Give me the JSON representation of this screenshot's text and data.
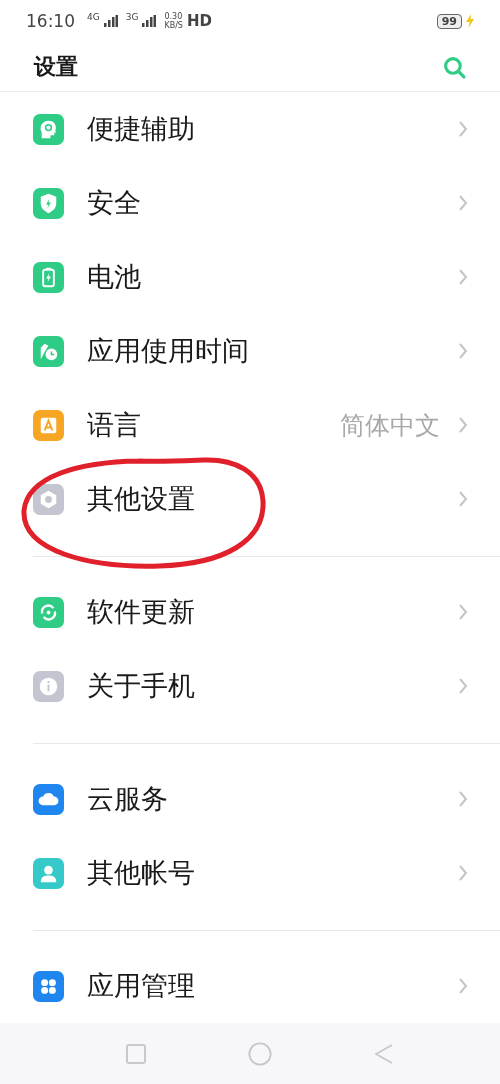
{
  "status_bar": {
    "time": "16:10",
    "network_1": "4G",
    "network_2": "3G",
    "speed": "0.30",
    "speed_unit": "KB/S",
    "hd": "HD",
    "battery": "99",
    "charging": true
  },
  "header": {
    "title": "设置"
  },
  "groups": [
    {
      "items": [
        {
          "label": "便捷辅助",
          "kind": "head",
          "color": "#2ecc85",
          "circled": false
        },
        {
          "label": "安全",
          "kind": "shield",
          "color": "#2ecc85",
          "circled": false
        },
        {
          "label": "电池",
          "kind": "battery",
          "color": "#2ecc85",
          "circled": false
        },
        {
          "label": "应用使用时间",
          "kind": "clock",
          "color": "#2ecc85",
          "circled": false
        },
        {
          "label": "语言",
          "kind": "letter",
          "color": "#f6a623",
          "value": "简体中文",
          "circled": false
        },
        {
          "label": "其他设置",
          "kind": "gear",
          "color": "#c3c6d1",
          "circled": true
        }
      ]
    },
    {
      "items": [
        {
          "label": "软件更新",
          "kind": "update",
          "color": "#2ecc85",
          "circled": false
        },
        {
          "label": "关于手机",
          "kind": "info",
          "color": "#c3c6d1",
          "circled": false
        }
      ]
    },
    {
      "items": [
        {
          "label": "云服务",
          "kind": "cloud",
          "color": "#1f86f0",
          "circled": false
        },
        {
          "label": "其他帐号",
          "kind": "person",
          "color": "#35c9c9",
          "circled": false
        }
      ]
    },
    {
      "items": [
        {
          "label": "应用管理",
          "kind": "apps",
          "color": "#1f86f0",
          "circled": false
        }
      ]
    }
  ]
}
